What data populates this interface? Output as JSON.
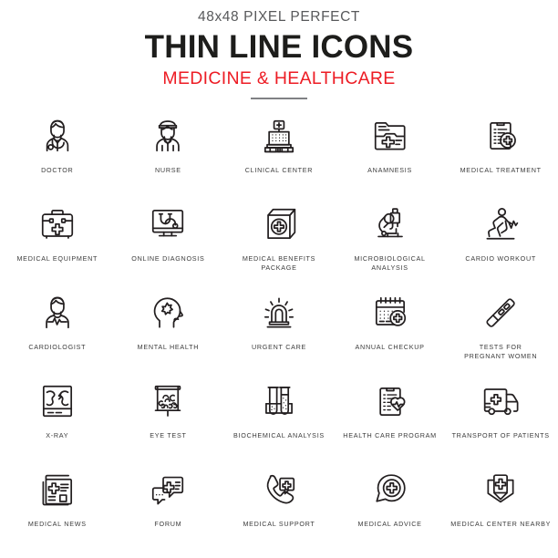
{
  "header": {
    "kicker": "48x48 PIXEL PERFECT",
    "title": "THIN LINE ICONS",
    "subtitle": "MEDICINE & HEALTHCARE",
    "divider_color": "#808184",
    "kicker_color": "#58595b",
    "title_color": "#1d1d1b",
    "subtitle_color": "#ed1c24"
  },
  "style": {
    "background": "#ffffff",
    "icon_stroke": "#231f20",
    "label_color": "#3b3b3b"
  },
  "grid": {
    "columns": 5,
    "rows": 5,
    "items": [
      {
        "label": "DOCTOR",
        "icon": "doctor-icon"
      },
      {
        "label": "NURSE",
        "icon": "nurse-icon"
      },
      {
        "label": "CLINICAL CENTER",
        "icon": "clinical-center-icon"
      },
      {
        "label": "ANAMNESIS",
        "icon": "anamnesis-folder-icon"
      },
      {
        "label": "MEDICAL TREATMENT",
        "icon": "medical-treatment-icon"
      },
      {
        "label": "MEDICAL EQUIPMENT",
        "icon": "first-aid-kit-icon"
      },
      {
        "label": "ONLINE DIAGNOSIS",
        "icon": "online-diagnosis-icon"
      },
      {
        "label": "MEDICAL BENEFITS\nPACKAGE",
        "icon": "medical-benefits-box-icon"
      },
      {
        "label": "MICROBIOLOGICAL\nANALYSIS",
        "icon": "microscope-icon"
      },
      {
        "label": "CARDIO WORKOUT",
        "icon": "cardio-workout-icon"
      },
      {
        "label": "CARDIOLOGIST",
        "icon": "cardiologist-icon"
      },
      {
        "label": "MENTAL HEALTH",
        "icon": "mental-health-icon"
      },
      {
        "label": "URGENT CARE",
        "icon": "urgent-care-siren-icon"
      },
      {
        "label": "ANNUAL CHECKUP",
        "icon": "annual-checkup-calendar-icon"
      },
      {
        "label": "TESTS FOR\nPREGNANT WOMEN",
        "icon": "pregnancy-test-icon"
      },
      {
        "label": "X-RAY",
        "icon": "x-ray-icon"
      },
      {
        "label": "EYE TEST",
        "icon": "eye-test-chart-icon"
      },
      {
        "label": "BIOCHEMICAL ANALYSIS",
        "icon": "test-tubes-icon"
      },
      {
        "label": "HEALTH CARE PROGRAM",
        "icon": "health-care-program-icon"
      },
      {
        "label": "TRANSPORT OF PATIENTS",
        "icon": "ambulance-icon"
      },
      {
        "label": "MEDICAL NEWS",
        "icon": "medical-news-icon"
      },
      {
        "label": "FORUM",
        "icon": "forum-chat-icon"
      },
      {
        "label": "MEDICAL SUPPORT",
        "icon": "medical-support-phone-icon"
      },
      {
        "label": "MEDICAL ADVICE",
        "icon": "medical-advice-bubble-icon"
      },
      {
        "label": "MEDICAL CENTER NEARBY",
        "icon": "medical-center-pin-icon"
      }
    ]
  }
}
